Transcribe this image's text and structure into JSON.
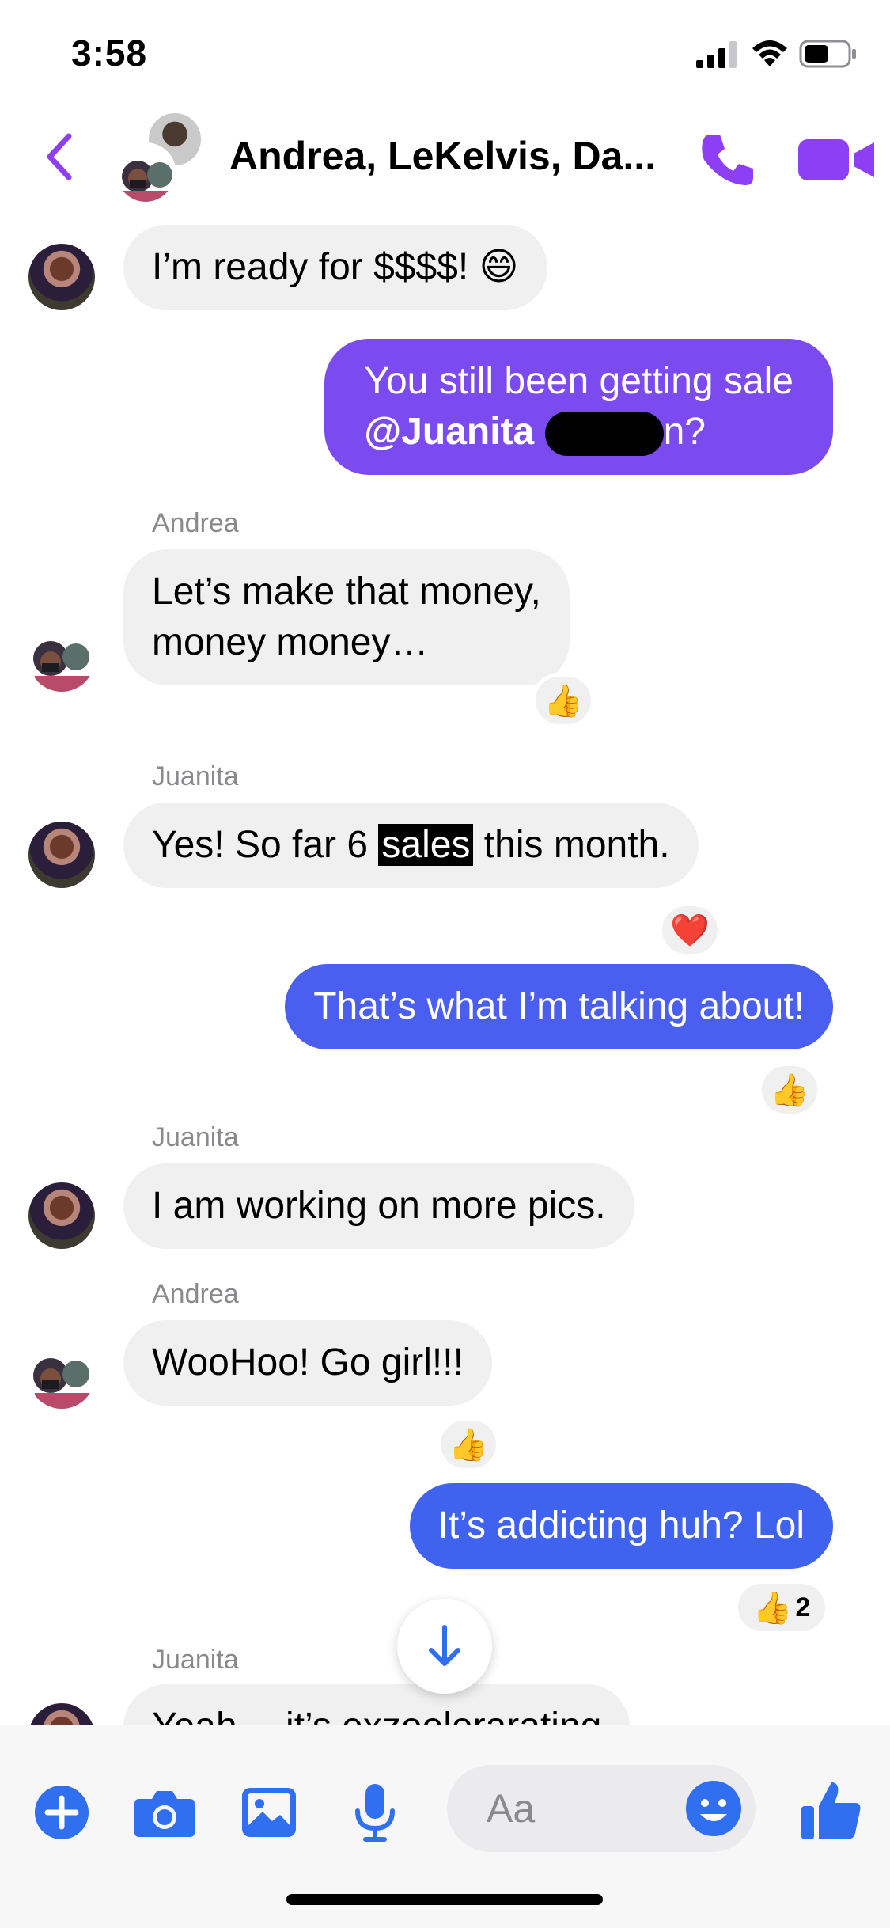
{
  "status_bar": {
    "time": "3:58"
  },
  "header": {
    "title": "Andrea, LeKelvis, Da..."
  },
  "colors": {
    "accent": "#8e3ff6",
    "bubble_purple": "#7b4bf0",
    "bubble_blue": "#4a5ef0",
    "bubble_blue2": "#3f63ee",
    "incoming_bg": "#f0f0f0",
    "composer_icon": "#2f6ff0"
  },
  "messages": [
    {
      "sender": "",
      "text": "I’m ready for $$$$! 😄",
      "direction": "in"
    },
    {
      "sender": "",
      "text_1": "You still been getting sale",
      "mention": "@Juanita",
      "suffix": "n?",
      "direction": "out"
    },
    {
      "sender": "Andrea",
      "text_1": "Let’s make that money,",
      "text_2": "money money…",
      "reaction": "👍",
      "direction": "in"
    },
    {
      "sender": "Juanita",
      "text_pre": "Yes! So far  6 ",
      "text_hl": "sales",
      "text_post": " this month.",
      "reaction": "❤️",
      "direction": "in"
    },
    {
      "sender": "",
      "text": "That’s what I’m talking about!",
      "reaction": "👍",
      "direction": "out"
    },
    {
      "sender": "Juanita",
      "text": "I am working on more pics.",
      "direction": "in"
    },
    {
      "sender": "Andrea",
      "text": "WooHoo! Go girl!!!",
      "reaction": "👍",
      "direction": "in"
    },
    {
      "sender": "",
      "text": "It’s addicting huh? Lol",
      "reaction": "👍",
      "reaction_count": "2",
      "direction": "out"
    },
    {
      "sender": "Juanita",
      "text": "Yeah… it’s exzeelerarating",
      "direction": "in"
    }
  ],
  "composer": {
    "placeholder": "Aa"
  },
  "icons": [
    "back-icon",
    "phone-icon",
    "video-icon",
    "plus-icon",
    "camera-icon",
    "gallery-icon",
    "microphone-icon",
    "emoji-icon",
    "like-icon",
    "arrow-down-icon"
  ]
}
